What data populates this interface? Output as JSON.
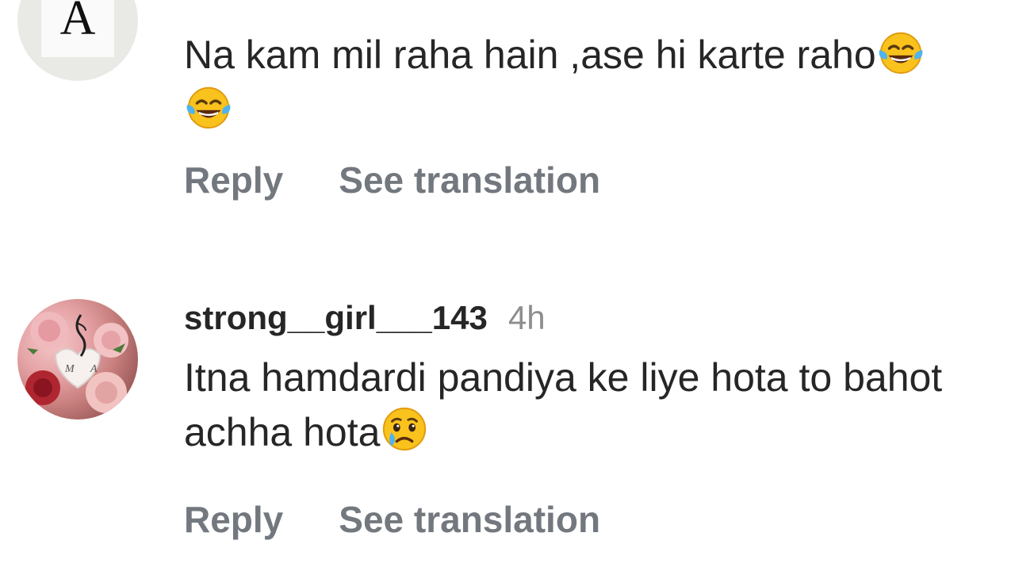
{
  "comments": [
    {
      "avatar_letter": "A",
      "avatar_icon": "letter-avatar",
      "username": "",
      "time": "",
      "text": "Na kam mil raha hain ,ase hi karte raho",
      "emojis": [
        "face-with-tears-of-joy",
        "face-with-tears-of-joy"
      ],
      "reply_label": "Reply",
      "translate_label": "See translation"
    },
    {
      "avatar_icon": "rose-photo-avatar",
      "username": "strong__girl___143",
      "time": "4h",
      "text": "Itna hamdardi pandiya ke liye hota to bahot achha hota",
      "emojis": [
        "crying-face"
      ],
      "reply_label": "Reply",
      "translate_label": "See translation"
    }
  ]
}
